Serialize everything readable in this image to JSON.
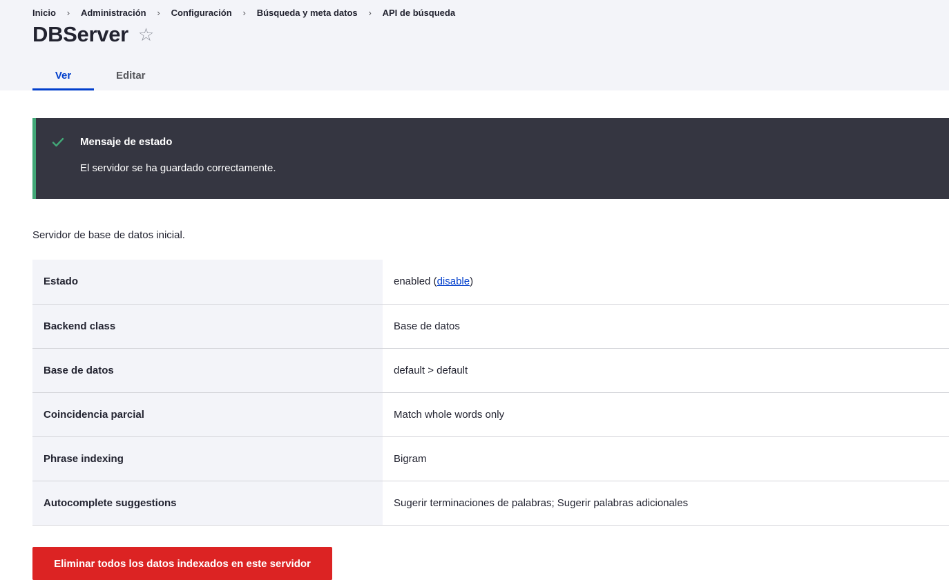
{
  "breadcrumb": [
    {
      "label": "Inicio"
    },
    {
      "label": "Administración"
    },
    {
      "label": "Configuración"
    },
    {
      "label": "Búsqueda y meta datos"
    },
    {
      "label": "API de búsqueda"
    }
  ],
  "breadcrumb_separator": "›",
  "page": {
    "title": "DBServer",
    "favorite_icon": "star-outline-icon",
    "favorite_glyph": "☆",
    "description": "Servidor de base de datos inicial."
  },
  "tabs": [
    {
      "label": "Ver",
      "active": true
    },
    {
      "label": "Editar",
      "active": false
    }
  ],
  "status_message": {
    "icon": "checkmark-icon",
    "title": "Mensaje de estado",
    "text": "El servidor se ha guardado correctamente.",
    "accent_color": "#42a877"
  },
  "details": {
    "estado": {
      "label": "Estado",
      "value": "enabled",
      "open_paren": " (",
      "link": "disable",
      "close_paren": ")"
    },
    "rows": [
      {
        "label": "Backend class",
        "value": "Base de datos"
      },
      {
        "label": "Base de datos",
        "value": "default > default"
      },
      {
        "label": "Coincidencia parcial",
        "value": "Match whole words only"
      },
      {
        "label": "Phrase indexing",
        "value": "Bigram"
      },
      {
        "label": "Autocomplete suggestions",
        "value": "Sugerir terminaciones de palabras; Sugerir palabras adicionales"
      }
    ]
  },
  "actions": {
    "delete_label": "Eliminar todos los datos indexados en este servidor",
    "delete_color": "#dc2323"
  },
  "colors": {
    "primary_link": "#003ecc",
    "header_bg": "#f3f4f9",
    "message_bg": "#353641"
  }
}
